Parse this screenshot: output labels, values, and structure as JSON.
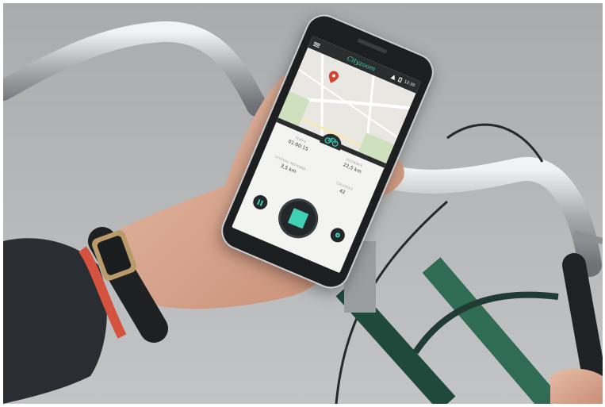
{
  "app": {
    "title": "Cityzoom",
    "status_time": "12:30"
  },
  "stats": {
    "duration_label": "TEMPS",
    "duration_value": "01:00:15",
    "distance_label": "DISTANCE",
    "distance_value": "22,5 km",
    "avg_speed_label": "VITESSE MOYENNE",
    "avg_speed_value": "3,5 km",
    "calories_label": "CALORIES",
    "calories_value": "42"
  },
  "icons": {
    "menu": "menu-icon",
    "mode": "bicycle-icon",
    "pause": "pause-icon",
    "stop": "stop-icon",
    "locate": "location-icon",
    "map_pin": "map-pin-icon"
  },
  "colors": {
    "accent": "#3ed1b6",
    "dark": "#242729",
    "pin": "#d8412f"
  }
}
